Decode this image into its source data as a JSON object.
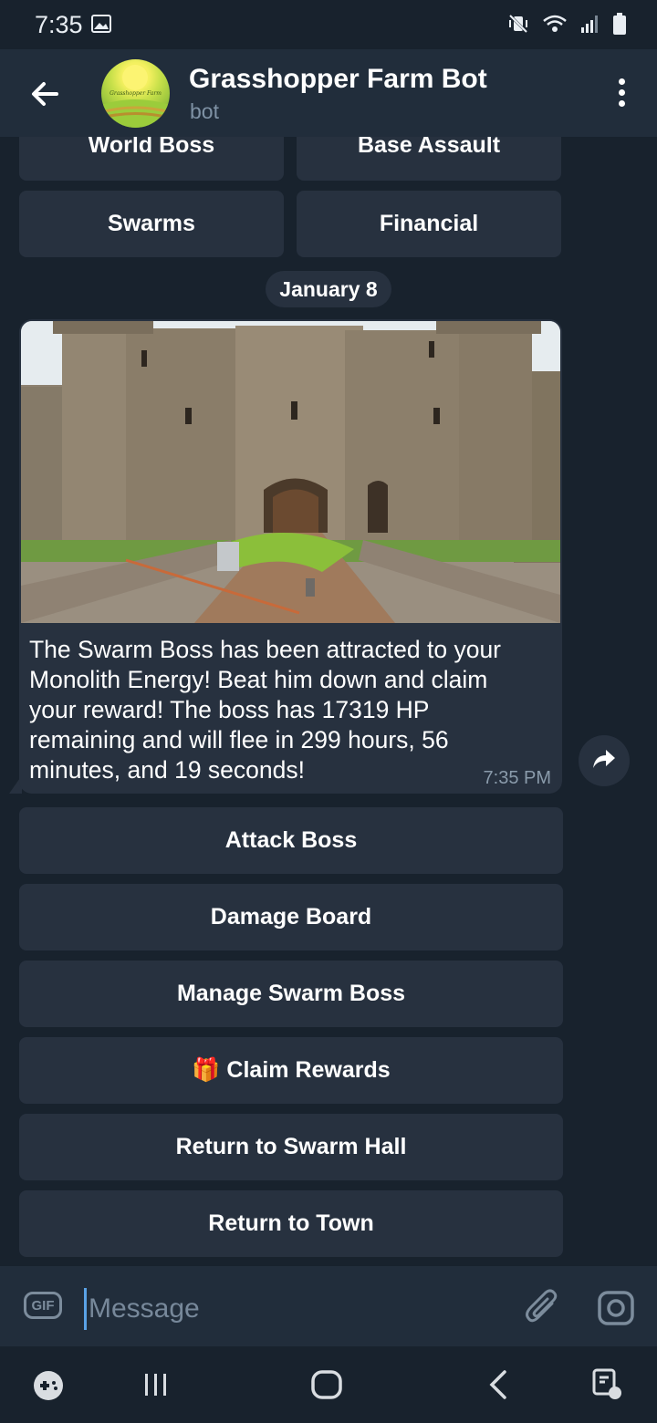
{
  "status_bar": {
    "time": "7:35",
    "icons": [
      "gallery-icon",
      "mute-vibrate-icon",
      "wifi-icon",
      "signal-icon",
      "battery-icon"
    ]
  },
  "header": {
    "title": "Grasshopper Farm Bot",
    "subtitle": "bot",
    "avatar_text": "Grasshopper Farm"
  },
  "top_keyboard": {
    "row1": [
      "World Boss",
      "Base Assault"
    ],
    "row2": [
      "Swarms",
      "Financial"
    ]
  },
  "date_label": "January 8",
  "message": {
    "text": "The Swarm Boss has been attracted to your Monolith Energy!  Beat him down and claim your reward!  The boss has 17319 HP remaining and will flee in 299 hours, 56 minutes, and 19 seconds!",
    "time": "7:35 PM"
  },
  "inline_keyboard": {
    "attack": "Attack Boss",
    "damage": "Damage Board",
    "manage": "Manage Swarm Boss",
    "claim": "🎁 Claim Rewards",
    "swarm_hall": "Return to Swarm Hall",
    "town": "Return to Town"
  },
  "input": {
    "gif_label": "GIF",
    "placeholder": "Message"
  },
  "colors": {
    "background": "#18222d",
    "header": "#212d3b",
    "bubble": "#27313f",
    "accent": "#5aa2e6"
  }
}
